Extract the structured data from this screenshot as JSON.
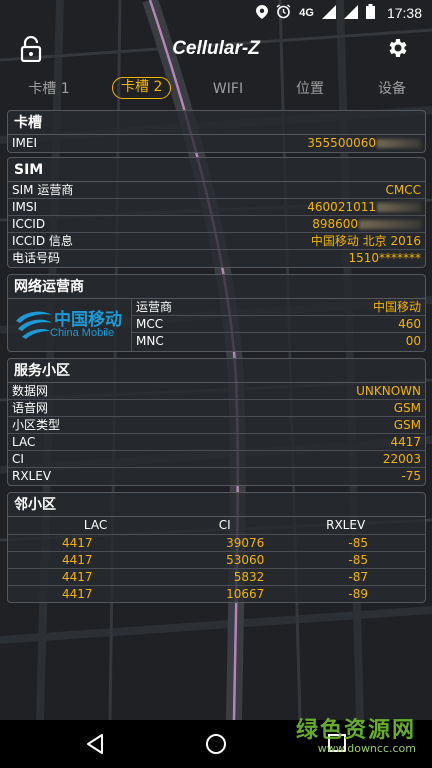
{
  "status": {
    "network": "4G",
    "time": "17:38"
  },
  "app": {
    "title": "Cellular-Z"
  },
  "tabs": [
    "卡槽 1",
    "卡槽 2",
    "WIFI",
    "位置",
    "设备"
  ],
  "slot": {
    "title": "卡槽",
    "imei_label": "IMEI",
    "imei_value": "355500060"
  },
  "sim": {
    "title": "SIM",
    "operator_label": "SIM 运营商",
    "operator_value": "CMCC",
    "imsi_label": "IMSI",
    "imsi_value": "460021011",
    "iccid_label": "ICCID",
    "iccid_value": "898600",
    "iccid_info_label": "ICCID 信息",
    "iccid_info_value": "中国移动 北京 2016",
    "phone_label": "电话号码",
    "phone_value": "1510*******"
  },
  "network_operator": {
    "title": "网络运营商",
    "logo_cn": "中国移动",
    "logo_en": "China Mobile",
    "carrier_label": "运营商",
    "carrier_value": "中国移动",
    "mcc_label": "MCC",
    "mcc_value": "460",
    "mnc_label": "MNC",
    "mnc_value": "00"
  },
  "serving_cell": {
    "title": "服务小区",
    "data_label": "数据网",
    "data_value": "UNKNOWN",
    "voice_label": "语音网",
    "voice_value": "GSM",
    "cell_type_label": "小区类型",
    "cell_type_value": "GSM",
    "lac_label": "LAC",
    "lac_value": "4417",
    "ci_label": "CI",
    "ci_value": "22003",
    "rxlev_label": "RXLEV",
    "rxlev_value": "-75"
  },
  "neighbors": {
    "title": "邻小区",
    "headers": [
      "LAC",
      "CI",
      "RXLEV"
    ],
    "rows": [
      [
        "4417",
        "39076",
        "-85"
      ],
      [
        "4417",
        "53060",
        "-85"
      ],
      [
        "4417",
        "5832",
        "-87"
      ],
      [
        "4417",
        "10667",
        "-89"
      ]
    ]
  },
  "watermark": {
    "line1": "绿色资源网",
    "line2": "www.downcc.com"
  },
  "colors": {
    "accent": "#f4b400",
    "background": "#1f2124",
    "card_border": "#55585c"
  }
}
